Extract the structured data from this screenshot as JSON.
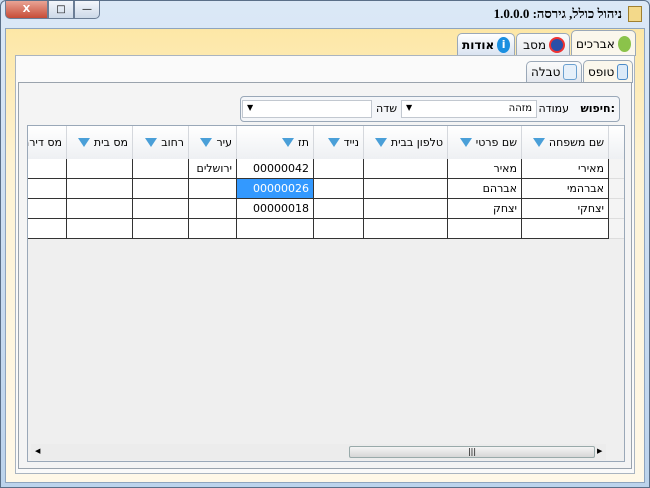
{
  "window": {
    "title": "ניהול כולל, גירסה: 1.0.0.0",
    "close_label": "X",
    "max_label": "□",
    "min_label": "—"
  },
  "main_tabs": [
    {
      "label": "אברכים",
      "icon": "users-icon",
      "selected": true
    },
    {
      "label": "מסב",
      "icon": "gear-wheel-icon"
    },
    {
      "label": "אודות",
      "icon": "info-icon"
    }
  ],
  "sub_tabs": [
    {
      "label": "טופס",
      "icon": "form-icon",
      "selected": true
    },
    {
      "label": "טבלה",
      "icon": "table-icon"
    }
  ],
  "search": {
    "label": "חיפוש:",
    "column_label": "עמודה",
    "column_value": "מזהה",
    "field_label": "שדה",
    "field_value": ""
  },
  "grid": {
    "columns": [
      "שם משפחה",
      "שם פרטי",
      "טלפון בבית",
      "נייד",
      "תז",
      "עיר",
      "רחוב",
      "מס בית",
      "מס דירה"
    ],
    "rows": [
      [
        "מאירי",
        "מאיר",
        "",
        "",
        "00000042",
        "ירושלים",
        "",
        "",
        ""
      ],
      [
        "אברהמי",
        "אברהם",
        "",
        "",
        "00000026",
        "",
        "",
        "",
        ""
      ],
      [
        "יצחקי",
        "יצחק",
        "",
        "",
        "00000018",
        "",
        "",
        "",
        ""
      ],
      [
        "",
        "",
        "",
        "",
        "",
        "",
        "",
        "",
        ""
      ]
    ],
    "selected_cell": {
      "row": 1,
      "column": 4
    },
    "scroll_grip": "|||"
  }
}
